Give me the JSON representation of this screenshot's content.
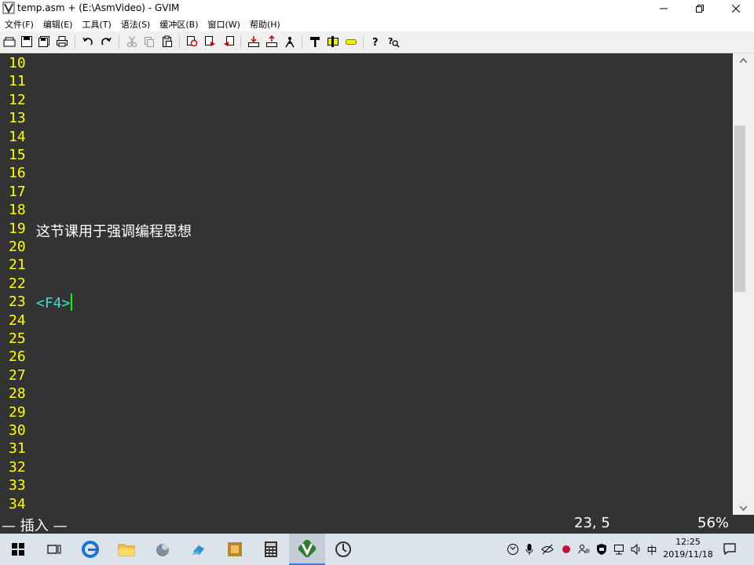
{
  "window": {
    "title": "temp.asm + (E:\\AsmVideo) - GVIM",
    "min_glyph": "—",
    "max_glyph": "❐",
    "close_glyph": "✕"
  },
  "menu": [
    "文件(F)",
    "编辑(E)",
    "工具(T)",
    "语法(S)",
    "缓冲区(B)",
    "窗口(W)",
    "帮助(H)"
  ],
  "toolbar": {
    "icons": [
      "open-icon",
      "save-icon",
      "save-all-icon",
      "print-icon",
      "undo-icon",
      "redo-icon",
      "cut-icon",
      "copy-icon",
      "paste-icon",
      "find-replace-icon",
      "find-next-icon",
      "find-prev-icon",
      "load-session-icon",
      "save-session-icon",
      "run-script-icon",
      "make-icon",
      "run-ctags-icon",
      "tag-jump-icon",
      "help-icon",
      "find-help-icon"
    ]
  },
  "editor": {
    "lines": [
      {
        "num": "10",
        "text": ""
      },
      {
        "num": "11",
        "text": ""
      },
      {
        "num": "12",
        "text": ""
      },
      {
        "num": "13",
        "text": ""
      },
      {
        "num": "14",
        "text": ""
      },
      {
        "num": "15",
        "text": ""
      },
      {
        "num": "16",
        "text": ""
      },
      {
        "num": "17",
        "text": ""
      },
      {
        "num": "18",
        "text": ""
      },
      {
        "num": "19",
        "text": "这节课用于强调编程思想"
      },
      {
        "num": "20",
        "text": ""
      },
      {
        "num": "21",
        "text": ""
      },
      {
        "num": "22",
        "text": ""
      },
      {
        "num": "23",
        "text": "<F4>",
        "special": true
      },
      {
        "num": "24",
        "text": ""
      },
      {
        "num": "25",
        "text": ""
      },
      {
        "num": "26",
        "text": ""
      },
      {
        "num": "27",
        "text": ""
      },
      {
        "num": "28",
        "text": ""
      },
      {
        "num": "29",
        "text": ""
      },
      {
        "num": "30",
        "text": ""
      },
      {
        "num": "31",
        "text": ""
      },
      {
        "num": "32",
        "text": ""
      },
      {
        "num": "33",
        "text": ""
      },
      {
        "num": "34",
        "text": ""
      }
    ],
    "colors": {
      "background": "#333333",
      "line_number": "#ffff00",
      "text": "#ffffff",
      "special_key": "#40e0d0",
      "cursor": "#00ff00"
    }
  },
  "status": {
    "mode": "— 插入 —",
    "position": "23, 5",
    "percent": "56%"
  },
  "taskbar": {
    "apps": [
      "start-icon",
      "task-view-icon",
      "edge-icon",
      "file-explorer-icon",
      "app-icon-1",
      "app-icon-2",
      "app-icon-3",
      "calculator-icon",
      "gvim-icon",
      "app-icon-4"
    ],
    "tray_ime": "中",
    "time": "12:25",
    "date": "2019/11/18"
  }
}
